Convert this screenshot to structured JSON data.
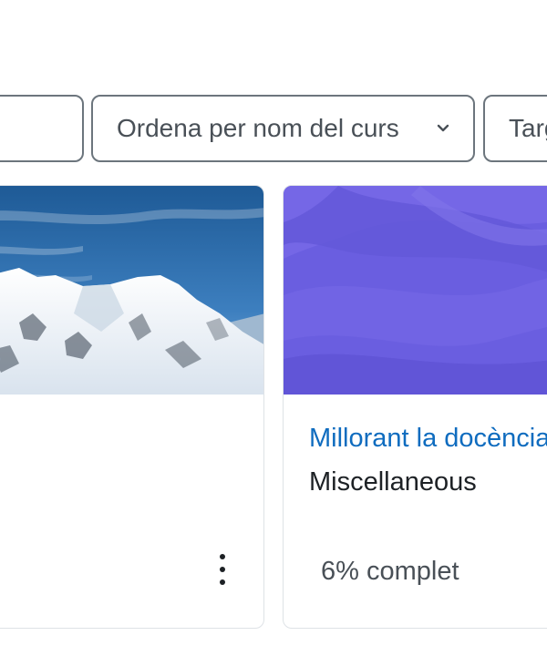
{
  "filters": {
    "search_value": "",
    "sort_label": "Ordena per nom del curs",
    "view_label": "Targetes"
  },
  "courses": [
    {
      "image": "mountain-snow-photo",
      "name": "",
      "category": "",
      "actions_icon": "kebab-menu-icon"
    },
    {
      "image": "purple-wave-pattern",
      "name": "Millorant la docència",
      "category": "Miscellaneous",
      "progress": "6% complet"
    }
  ],
  "colors": {
    "link": "#0f6cbf",
    "border": "#6c757d",
    "card_border": "#dee2e6",
    "purple_base": "#6a5ee0"
  }
}
